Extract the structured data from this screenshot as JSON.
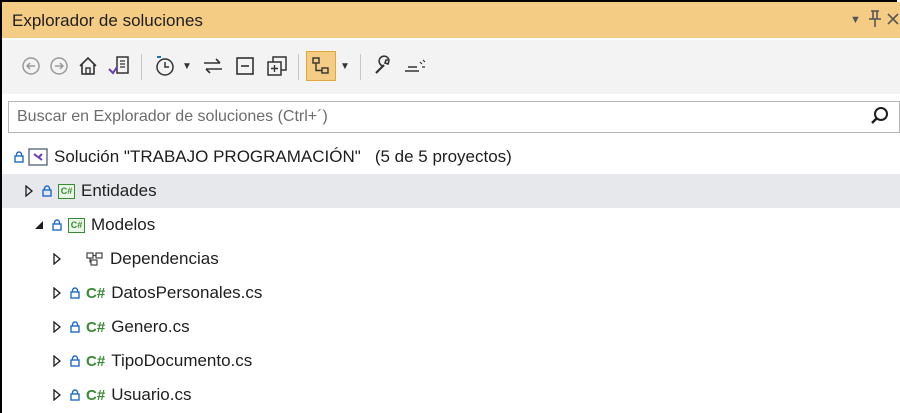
{
  "window": {
    "title": "Explorador de soluciones",
    "controls": {
      "dropdown": "▼",
      "pin": "ǂ",
      "close": "✕"
    }
  },
  "toolbar": {
    "icons": [
      "back-icon",
      "forward-icon",
      "home-icon",
      "switch-views-icon",
      "pending-changes-filter-icon",
      "dropdown-icon",
      "sync-icon",
      "collapse-all-icon",
      "copy-icon",
      "show-all-files-icon",
      "dropdown-icon",
      "properties-icon",
      "preview-icon"
    ]
  },
  "search": {
    "placeholder": "Buscar en Explorador de soluciones (Ctrl+´)"
  },
  "tree": {
    "solution": {
      "name": "Solución \"TRABAJO PROGRAMACIÓN\"",
      "count": "(5 de 5 proyectos)"
    },
    "projects": [
      {
        "name": "Entidades",
        "expanded": false
      },
      {
        "name": "Modelos",
        "expanded": true,
        "children": [
          {
            "name": "Dependencias",
            "type": "dependencies"
          },
          {
            "name": "DatosPersonales.cs",
            "type": "cs-file"
          },
          {
            "name": "Genero.cs",
            "type": "cs-file"
          },
          {
            "name": "TipoDocumento.cs",
            "type": "cs-file"
          },
          {
            "name": "Usuario.cs",
            "type": "cs-file"
          }
        ]
      }
    ],
    "glyphs": {
      "collapsed": "▷",
      "expanded": "◢",
      "lock": "🔒",
      "cs_badge": "C#"
    }
  },
  "colors": {
    "title_bg": "#f5cc84",
    "selected_row": "#e7e8ec",
    "csharp_green": "#388a34",
    "lock_blue": "#1f6cc5"
  }
}
